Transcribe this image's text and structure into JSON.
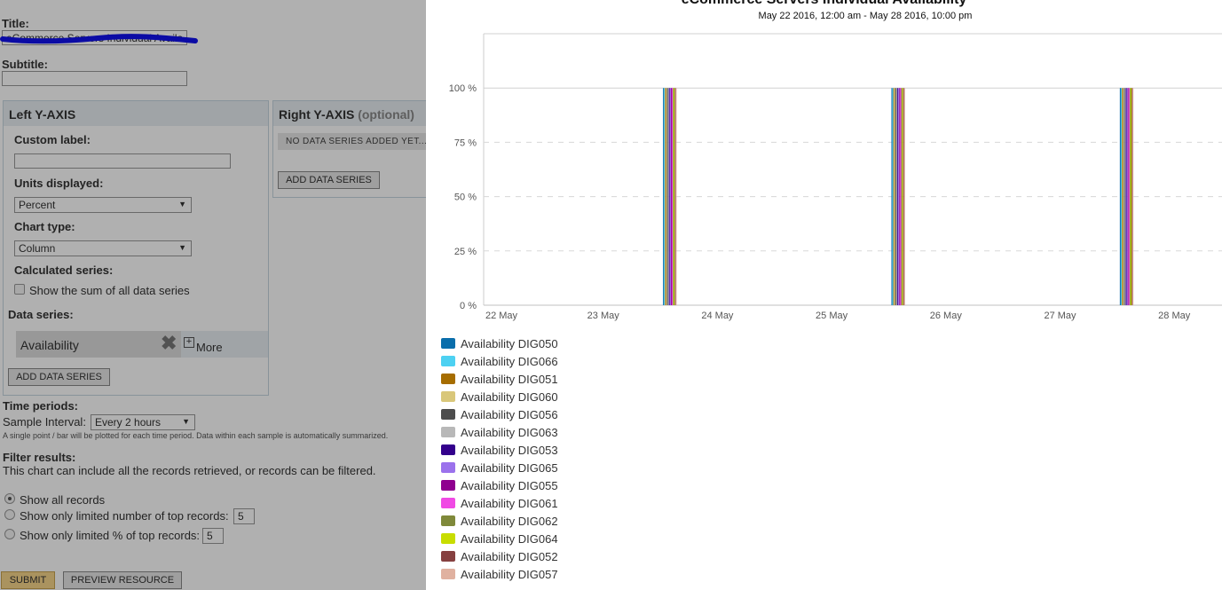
{
  "form": {
    "title_label": "Title:",
    "title_value": "eCommerce Servers Individual Availa",
    "subtitle_label": "Subtitle:",
    "subtitle_value": "",
    "left_axis": {
      "header": "Left Y-AXIS",
      "custom_label": "Custom label:",
      "custom_value": "",
      "units_label": "Units displayed:",
      "units_value": "Percent",
      "chart_type_label": "Chart type:",
      "chart_type_value": "Column",
      "calculated_label": "Calculated series:",
      "sum_checkbox_label": "Show the sum of all data series",
      "sum_checked": false,
      "data_series_label": "Data series:",
      "series_item": "Availability",
      "more_label": "More",
      "add_series": "ADD DATA SERIES"
    },
    "right_axis": {
      "header": "Right Y-AXIS",
      "header_optional": "(optional)",
      "empty_text": "NO DATA SERIES ADDED YET...",
      "add_series": "ADD DATA SERIES"
    },
    "time_periods_label": "Time periods:",
    "sample_interval_label": "Sample Interval:",
    "sample_interval_value": "Every 2 hours",
    "sample_note": "A single point / bar will be plotted for each time period. Data within each sample is automatically summarized.",
    "filter_label": "Filter results:",
    "filter_text": "This chart can include all the records retrieved, or records can be filtered.",
    "radios": [
      {
        "label": "Show all records",
        "checked": true
      },
      {
        "label": "Show only limited number of top records:",
        "value": "5",
        "checked": false
      },
      {
        "label": "Show only limited % of top records:",
        "value": "5",
        "checked": false
      }
    ],
    "submit": "SUBMIT",
    "preview": "PREVIEW RESOURCE"
  },
  "chart_data": {
    "type": "bar",
    "title": "eCommerce Servers Individual Availability",
    "subtitle": "May 22 2016, 12:00 am - May 28 2016, 10:00 pm",
    "y_ticks": [
      "0 %",
      "25 %",
      "50 %",
      "75 %",
      "100 %"
    ],
    "ylim": [
      0,
      125
    ],
    "x_ticks": [
      "22 May",
      "23 May",
      "24 May",
      "25 May",
      "26 May",
      "27 May",
      "28 May"
    ],
    "xlim": [
      "2016-05-22 00:00",
      "2016-05-28 10:00"
    ],
    "x": [
      "2016-05-23 14:00",
      "2016-05-25 14:00",
      "2016-05-27 14:00"
    ],
    "grid": true,
    "legend_position": "bottom-left",
    "series": [
      {
        "name": "Availability DIG050",
        "color": "#0a6eab",
        "values": [
          100,
          100,
          100
        ]
      },
      {
        "name": "Availability DIG066",
        "color": "#4dd1f2",
        "values": [
          100,
          100,
          100
        ]
      },
      {
        "name": "Availability DIG051",
        "color": "#a66d00",
        "values": [
          100,
          100,
          100
        ]
      },
      {
        "name": "Availability DIG060",
        "color": "#d9c77a",
        "values": [
          100,
          100,
          100
        ]
      },
      {
        "name": "Availability DIG056",
        "color": "#4d4d4d",
        "values": [
          100,
          100,
          100
        ]
      },
      {
        "name": "Availability DIG063",
        "color": "#b8b8b8",
        "values": [
          100,
          100,
          100
        ]
      },
      {
        "name": "Availability DIG053",
        "color": "#33008c",
        "values": [
          100,
          100,
          100
        ]
      },
      {
        "name": "Availability DIG065",
        "color": "#9b72ec",
        "values": [
          100,
          100,
          100
        ]
      },
      {
        "name": "Availability DIG055",
        "color": "#8f008f",
        "values": [
          100,
          100,
          100
        ]
      },
      {
        "name": "Availability DIG061",
        "color": "#f04ae4",
        "values": [
          100,
          100,
          100
        ]
      },
      {
        "name": "Availability DIG062",
        "color": "#7f893a",
        "values": [
          100,
          100,
          100
        ]
      },
      {
        "name": "Availability DIG064",
        "color": "#c8dd00",
        "values": [
          100,
          100,
          100
        ]
      },
      {
        "name": "Availability DIG052",
        "color": "#864040",
        "values": [
          100,
          100,
          100
        ]
      },
      {
        "name": "Availability DIG057",
        "color": "#e0b1a0",
        "values": [
          100,
          100,
          100
        ]
      }
    ]
  }
}
